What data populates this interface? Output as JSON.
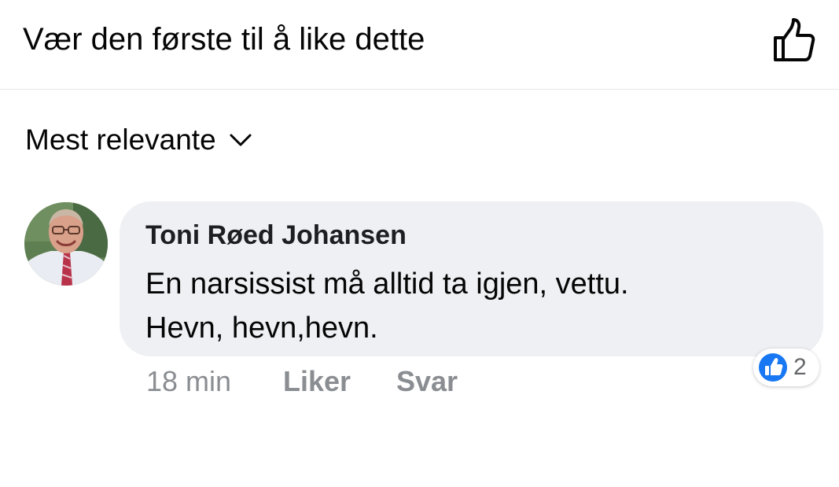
{
  "header": {
    "text": "Vær den første til å like dette",
    "like_icon": "thumbs-up-outline-icon"
  },
  "sort": {
    "label": "Mest relevante",
    "icon": "chevron-down-icon"
  },
  "comment": {
    "author": "Toni Røed Johansen",
    "text_lines": [
      "En narsissist må alltid ta igjen, vettu.",
      "Hevn, hevn,hevn."
    ],
    "time": "18 min",
    "like_label": "Liker",
    "reply_label": "Svar",
    "reaction": {
      "icon": "like-reaction-icon",
      "count": "2"
    }
  },
  "colors": {
    "bubble_background": "#eff0f4",
    "secondary_text": "#8a8d91",
    "reaction_blue": "#1877f2"
  }
}
